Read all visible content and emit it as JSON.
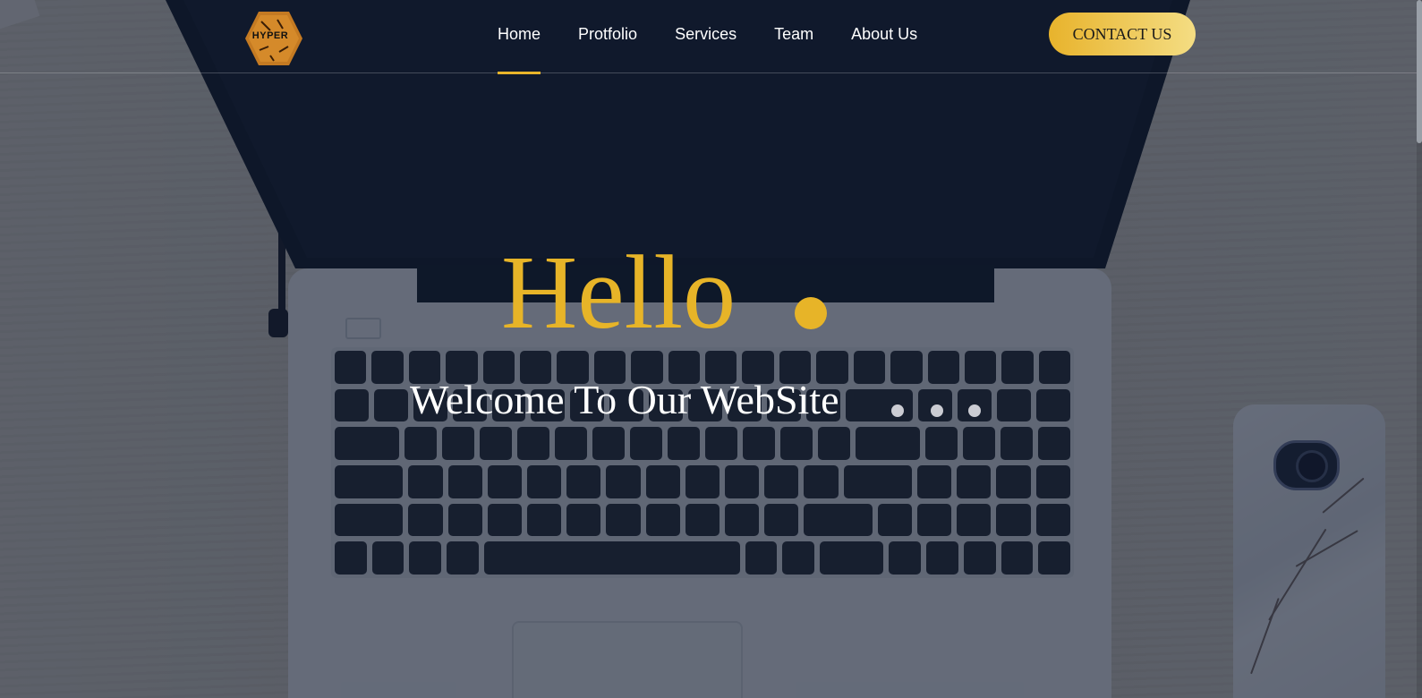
{
  "header": {
    "logo_text": "HYPER",
    "nav": [
      {
        "label": "Home",
        "active": true
      },
      {
        "label": "Protfolio",
        "active": false
      },
      {
        "label": "Services",
        "active": false
      },
      {
        "label": "Team",
        "active": false
      },
      {
        "label": "About Us",
        "active": false
      }
    ],
    "contact_label": "CONTACT US"
  },
  "hero": {
    "title": "Hello",
    "subtitle": "Welcome To Our WebSite"
  },
  "colors": {
    "accent": "#e7b428",
    "overlay": "#101a2e",
    "nav_text": "#ffffff"
  }
}
